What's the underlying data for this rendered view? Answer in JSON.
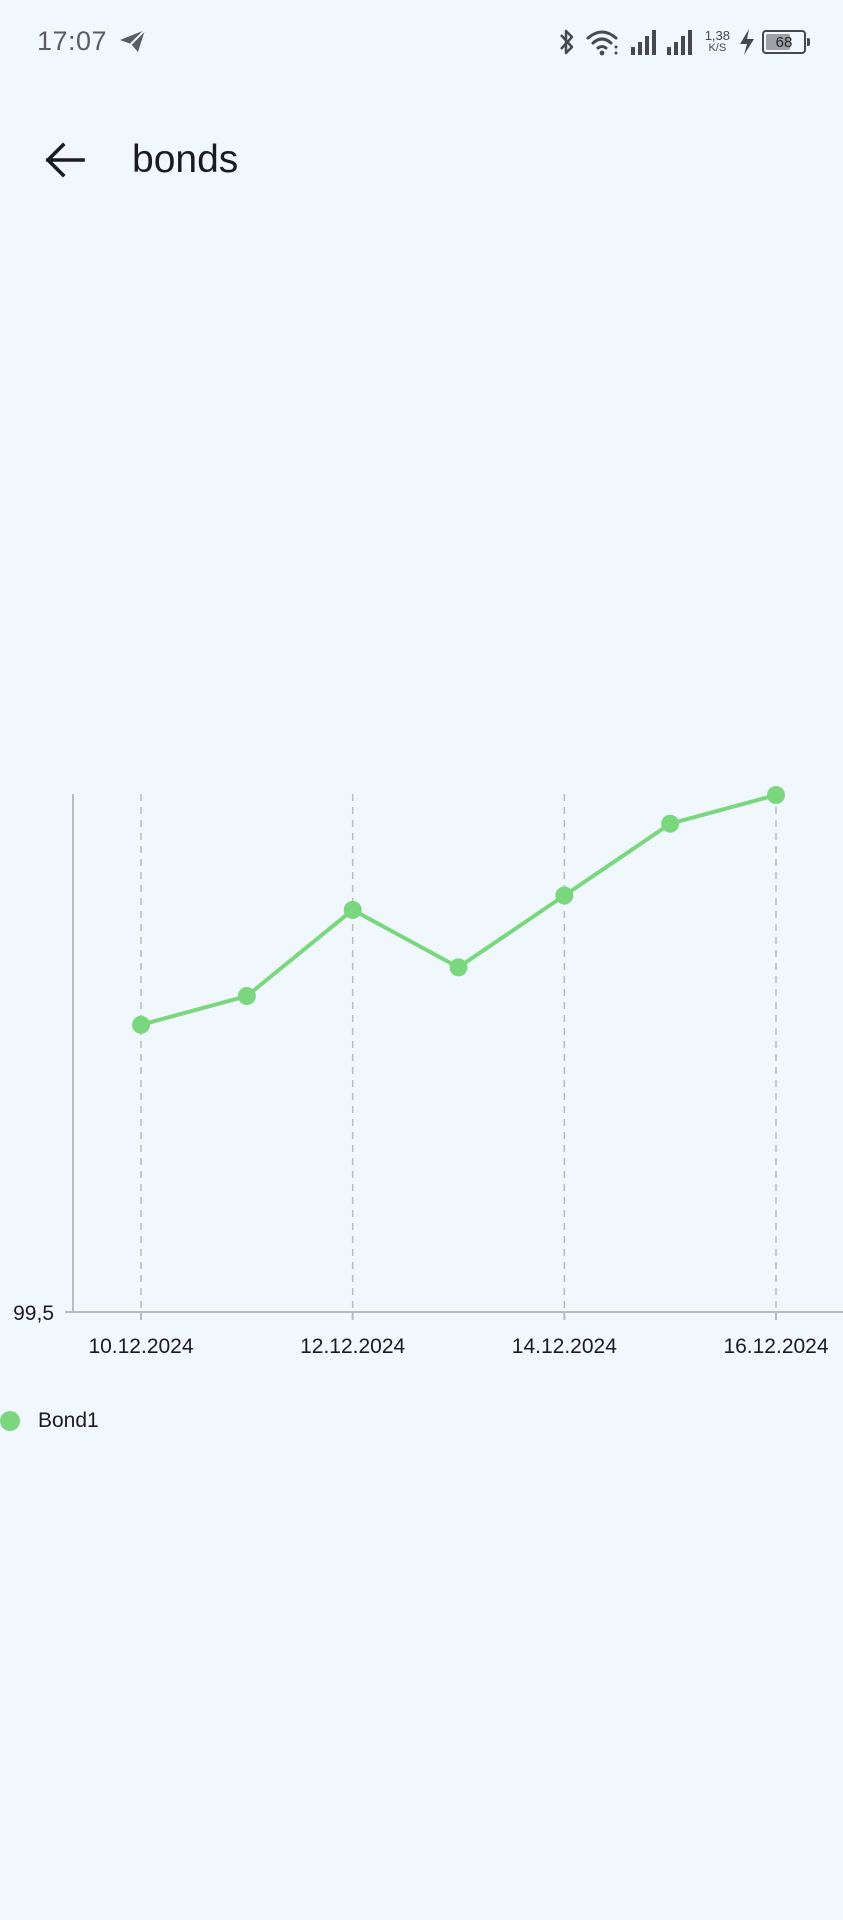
{
  "status_bar": {
    "time": "17:07",
    "speed_value": "1,38",
    "speed_unit": "K/S",
    "battery_level": "68",
    "icons": [
      "telegram-send-icon",
      "bluetooth-icon",
      "wifi-icon",
      "signal-icon",
      "signal-icon",
      "charging-bolt-icon",
      "battery-icon"
    ]
  },
  "app_bar": {
    "back_icon": "arrow-left-icon",
    "title": "bonds"
  },
  "colors": {
    "background": "#f0f7fd",
    "series": "#7bd77e",
    "axis": "#b9bcbf",
    "grid": "#b9bcbf",
    "text": "#1b1b1f"
  },
  "chart_data": {
    "type": "line",
    "x_axis_type": "date",
    "x": [
      "10.12.2024",
      "11.12.2024",
      "12.12.2024",
      "13.12.2024",
      "14.12.2024",
      "15.12.2024",
      "16.12.2024"
    ],
    "x_tick_labels": [
      "10.12.2024",
      "12.12.2024",
      "14.12.2024",
      "16.12.2024"
    ],
    "x_tick_values": [
      "10.12.2024",
      "12.12.2024",
      "14.12.2024",
      "16.12.2024"
    ],
    "y_tick_labels": [
      "99,5"
    ],
    "y_tick_values": [
      99.5
    ],
    "ylim": [
      99.5,
      null
    ],
    "grid": "vertical-dashed",
    "legend_position": "bottom-left",
    "series": [
      {
        "name": "Bond1",
        "values": [
          99.7,
          99.72,
          99.78,
          99.74,
          99.79,
          99.84,
          99.86
        ]
      }
    ]
  },
  "legend": {
    "items": [
      {
        "label": "Bond1",
        "color": "#7bd77e"
      }
    ]
  }
}
